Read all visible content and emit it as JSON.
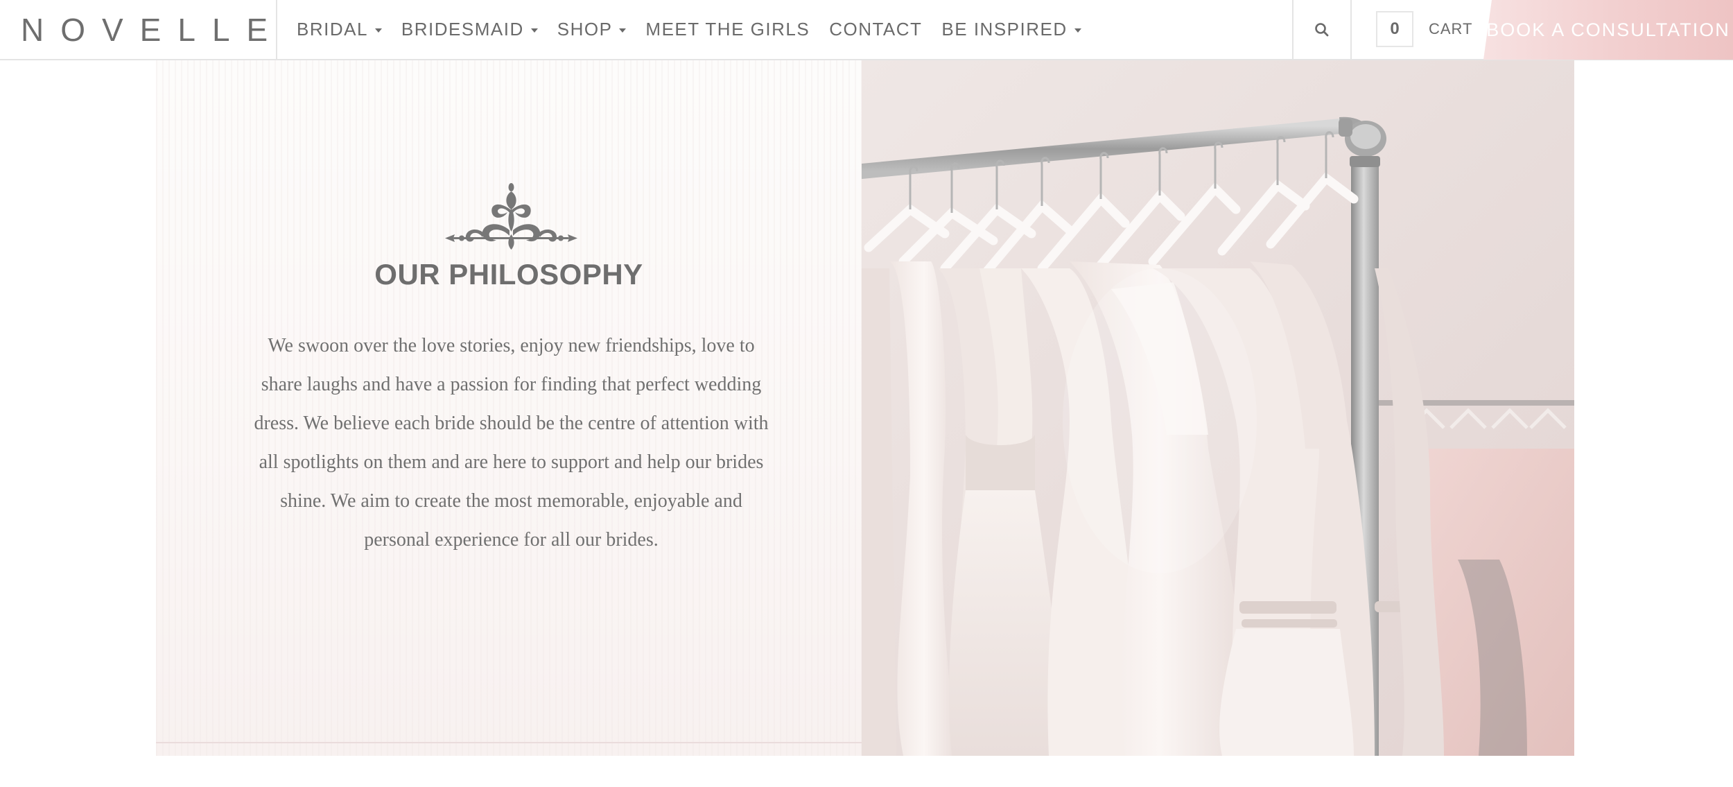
{
  "brand": {
    "logo_text": "NOVELLE"
  },
  "nav": {
    "items": [
      {
        "label": "BRIDAL",
        "has_dropdown": true
      },
      {
        "label": "BRIDESMAID",
        "has_dropdown": true
      },
      {
        "label": "SHOP",
        "has_dropdown": true
      },
      {
        "label": "MEET THE GIRLS",
        "has_dropdown": false
      },
      {
        "label": "CONTACT",
        "has_dropdown": false
      },
      {
        "label": "BE INSPIRED",
        "has_dropdown": true
      }
    ]
  },
  "header": {
    "search_icon": "search-icon",
    "cart_count": "0",
    "cart_label": "CART",
    "cta_label": "BOOK A CONSULTATION"
  },
  "philosophy": {
    "ornament_icon": "fleur-ornament-icon",
    "title": "OUR PHILOSOPHY",
    "body": "We swoon over the love stories, enjoy new friendships, love to share laughs and have a passion for finding that perfect wedding dress. We believe each bride should be the centre of attention with all spotlights on them and are here to support and help our brides shine. We aim to create the most memorable, enjoyable and personal experience for all our brides."
  },
  "image": {
    "subject": "wedding-dresses-on-rack"
  },
  "colors": {
    "text_gray": "#6e6e6e",
    "accent_pink": "#f2cfcf",
    "divider": "#e4e4e4"
  }
}
